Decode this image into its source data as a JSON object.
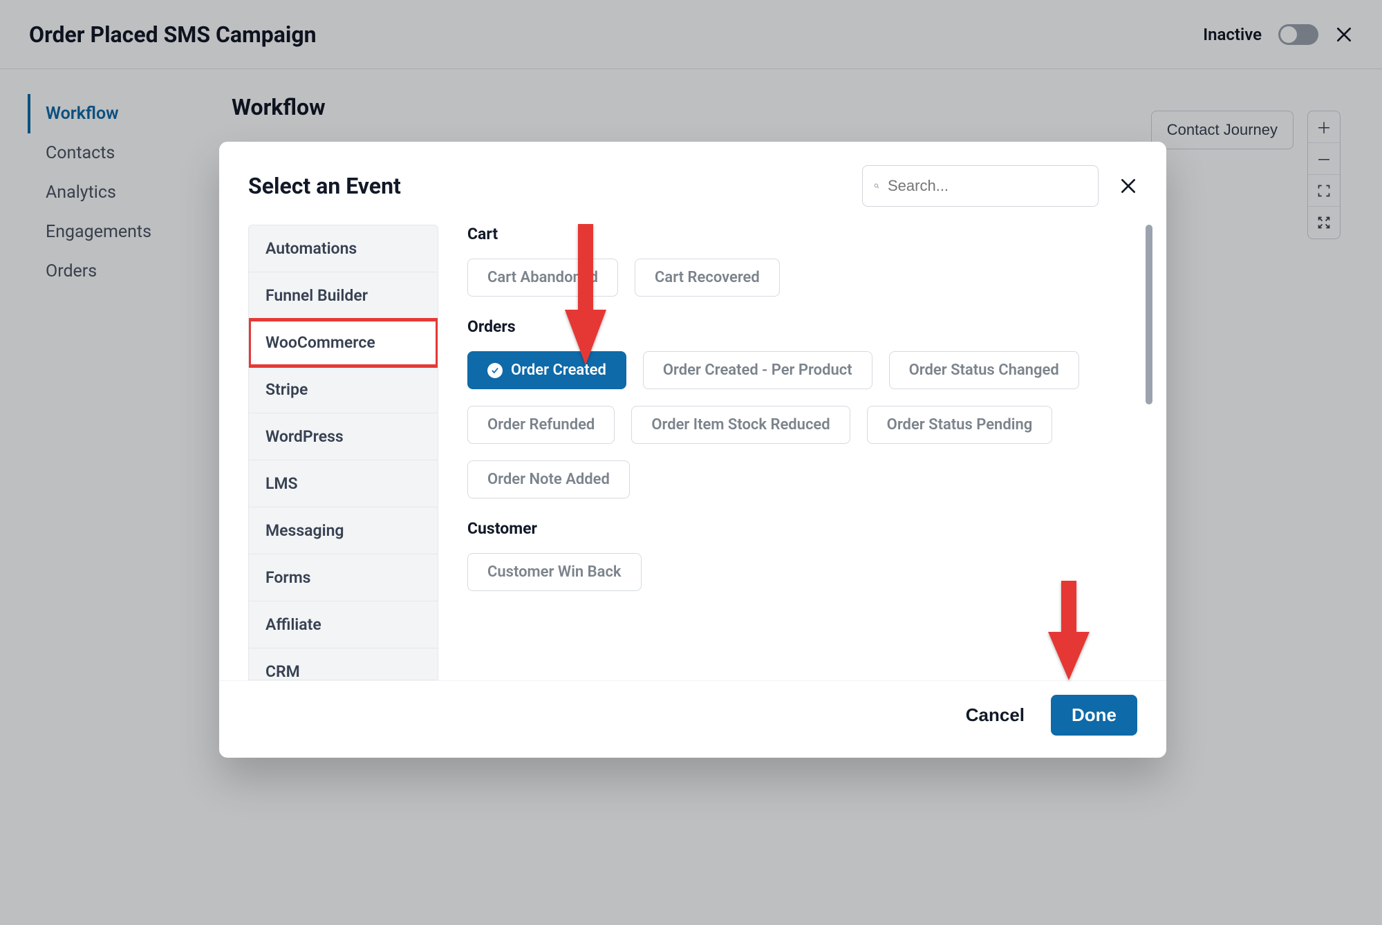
{
  "header": {
    "title": "Order Placed SMS Campaign",
    "status_label": "Inactive"
  },
  "side_nav": {
    "items": [
      "Workflow",
      "Contacts",
      "Analytics",
      "Engagements",
      "Orders"
    ],
    "active_index": 0
  },
  "content": {
    "heading": "Workflow",
    "journey_button": "Contact Journey"
  },
  "modal": {
    "title": "Select an Event",
    "search_placeholder": "Search...",
    "cancel_label": "Cancel",
    "done_label": "Done",
    "categories": [
      "Automations",
      "Funnel Builder",
      "WooCommerce",
      "Stripe",
      "WordPress",
      "LMS",
      "Messaging",
      "Forms",
      "Affiliate",
      "CRM"
    ],
    "active_category_index": 2,
    "highlight_category_index": 2,
    "sections": [
      {
        "title": "Cart",
        "events": [
          {
            "label": "Cart Abandoned",
            "selected": false
          },
          {
            "label": "Cart Recovered",
            "selected": false
          }
        ]
      },
      {
        "title": "Orders",
        "events": [
          {
            "label": "Order Created",
            "selected": true
          },
          {
            "label": "Order Created - Per Product",
            "selected": false
          },
          {
            "label": "Order Status Changed",
            "selected": false
          },
          {
            "label": "Order Refunded",
            "selected": false
          },
          {
            "label": "Order Item Stock Reduced",
            "selected": false
          },
          {
            "label": "Order Status Pending",
            "selected": false
          },
          {
            "label": "Order Note Added",
            "selected": false
          }
        ]
      },
      {
        "title": "Customer",
        "events": [
          {
            "label": "Customer Win Back",
            "selected": false
          }
        ]
      }
    ]
  },
  "colors": {
    "primary": "#0e6aa8",
    "annotation_red": "#e53935"
  }
}
